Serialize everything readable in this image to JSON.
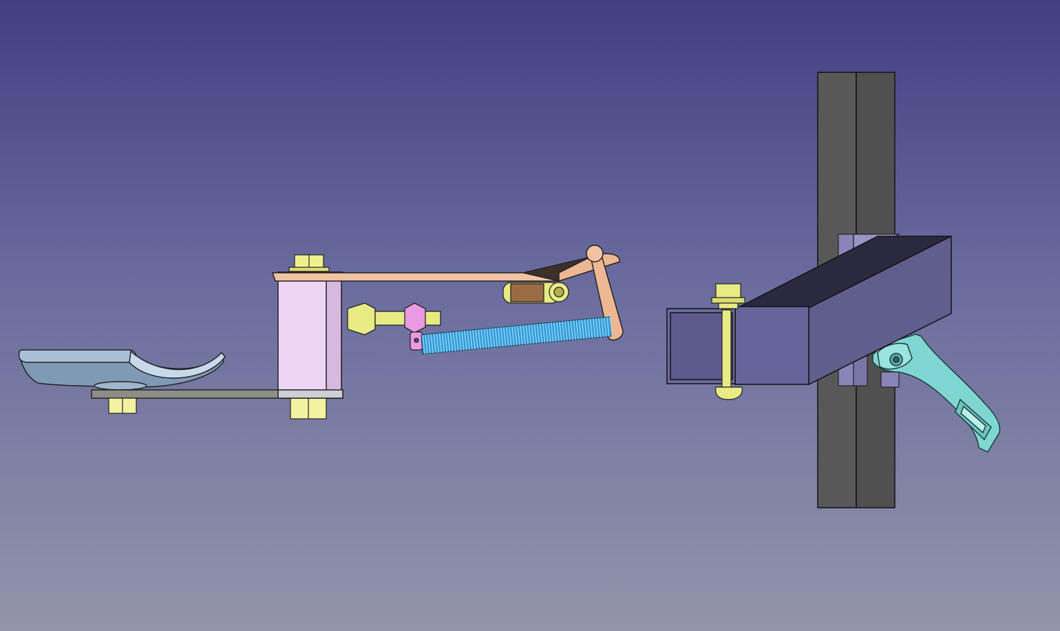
{
  "viewport": {
    "background_top": "#423e82",
    "background_bottom": "#9394aa"
  },
  "parts": [
    {
      "name": "pedal-tray",
      "color": "#8aa3bd"
    },
    {
      "name": "base-plate",
      "color": "#8d8f86"
    },
    {
      "name": "pivot-bushing",
      "color": "#f0d6f5"
    },
    {
      "name": "lever-arm",
      "color": "#eeb793"
    },
    {
      "name": "tension-spring",
      "color": "#2f9ad6"
    },
    {
      "name": "adjustment-bolt",
      "color": "#e8ea84"
    },
    {
      "name": "spring-hook",
      "color": "#e89be0"
    },
    {
      "name": "roller",
      "color": "#9b6b45"
    },
    {
      "name": "link-rod",
      "color": "#eeb793"
    },
    {
      "name": "square-tube-mount",
      "color": "#5f5e8c"
    },
    {
      "name": "vertical-post",
      "color": "#4f4f4f"
    },
    {
      "name": "clamp-bracket",
      "color": "#8580b0"
    },
    {
      "name": "quick-release-lever",
      "color": "#7fd7d3"
    },
    {
      "name": "mount-bolt",
      "color": "#e8ea84"
    }
  ]
}
